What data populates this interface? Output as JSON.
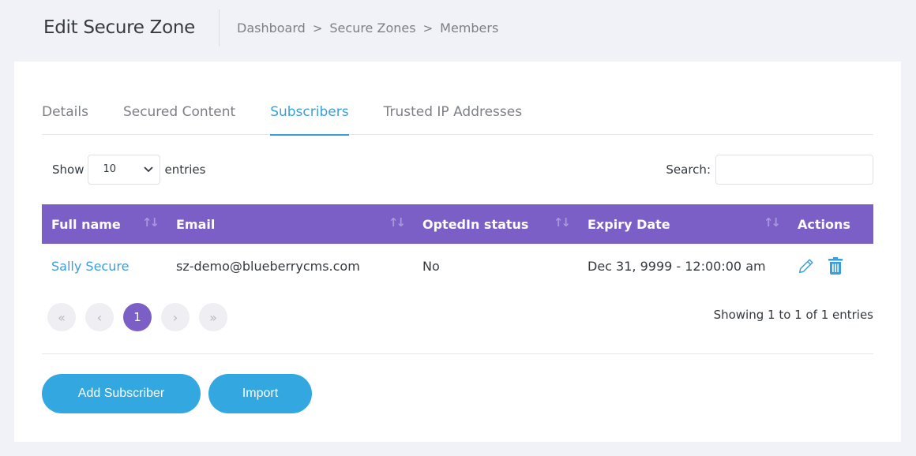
{
  "header": {
    "title": "Edit Secure Zone",
    "breadcrumb": [
      "Dashboard",
      "Secure Zones",
      "Members"
    ],
    "breadcrumb_separator": ">"
  },
  "tabs": [
    {
      "label": "Details",
      "active": false
    },
    {
      "label": "Secured Content",
      "active": false
    },
    {
      "label": "Subscribers",
      "active": true
    },
    {
      "label": "Trusted IP Addresses",
      "active": false
    }
  ],
  "table_controls": {
    "show_label": "Show",
    "page_size": "10",
    "entries_label": "entries",
    "search_label": "Search:",
    "search_value": ""
  },
  "table": {
    "columns": [
      "Full name",
      "Email",
      "OptedIn status",
      "Expiry Date",
      "Actions"
    ],
    "rows": [
      {
        "full_name": "Sally Secure",
        "email": "sz-demo@blueberrycms.com",
        "opted_in": "No",
        "expiry": "Dec 31, 9999 - 12:00:00 am"
      }
    ]
  },
  "pagination": {
    "first": "«",
    "prev": "‹",
    "current": "1",
    "next": "›",
    "last": "»",
    "summary": "Showing 1 to 1 of 1 entries"
  },
  "buttons": {
    "add_subscriber": "Add Subscriber",
    "import": "Import"
  },
  "colors": {
    "accent": "#3a9fd8",
    "header_purple": "#7b5ec6",
    "button_blue": "#33a8e0"
  }
}
